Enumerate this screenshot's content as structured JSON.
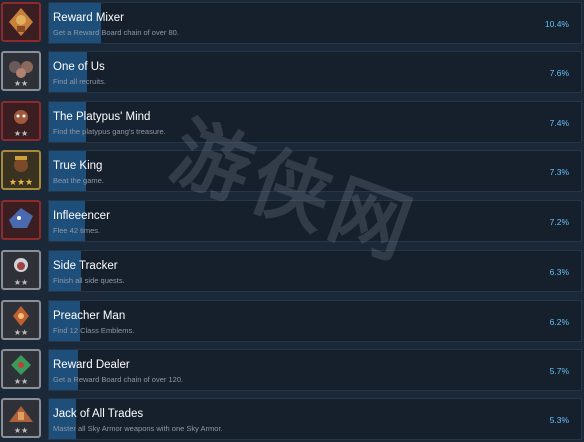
{
  "achievements": [
    {
      "title": "Reward Mixer",
      "description": "Get a Reward Board chain of over 80.",
      "percent": "10.4%",
      "percent_value": 10.4,
      "icon": "achievement-reward-mixer",
      "frame": "red"
    },
    {
      "title": "One of Us",
      "description": "Find all recruits.",
      "percent": "7.6%",
      "percent_value": 7.6,
      "icon": "achievement-one-of-us",
      "frame": "silver"
    },
    {
      "title": "The Platypus' Mind",
      "description": "Find the platypus gang's treasure.",
      "percent": "7.4%",
      "percent_value": 7.4,
      "icon": "achievement-platypus-mind",
      "frame": "red"
    },
    {
      "title": "True King",
      "description": "Beat the game.",
      "percent": "7.3%",
      "percent_value": 7.3,
      "icon": "achievement-true-king",
      "frame": "gold"
    },
    {
      "title": "Infleeencer",
      "description": "Flee 42 times.",
      "percent": "7.2%",
      "percent_value": 7.2,
      "icon": "achievement-infleeencer",
      "frame": "red"
    },
    {
      "title": "Side Tracker",
      "description": "Finish all side quests.",
      "percent": "6.3%",
      "percent_value": 6.3,
      "icon": "achievement-side-tracker",
      "frame": "silver"
    },
    {
      "title": "Preacher Man",
      "description": "Find 12 Class Emblems.",
      "percent": "6.2%",
      "percent_value": 6.2,
      "icon": "achievement-preacher-man",
      "frame": "silver"
    },
    {
      "title": "Reward Dealer",
      "description": "Get a Reward Board chain of over 120.",
      "percent": "5.7%",
      "percent_value": 5.7,
      "icon": "achievement-reward-dealer",
      "frame": "silver"
    },
    {
      "title": "Jack of All Trades",
      "description": "Master all Sky Armor weapons with one Sky Armor.",
      "percent": "5.3%",
      "percent_value": 5.3,
      "icon": "achievement-jack-of-all-trades",
      "frame": "silver"
    }
  ],
  "watermark": "游侠网",
  "colors": {
    "background": "#1b2838",
    "fill": "#1e4e7a",
    "percent": "#66c0f4"
  }
}
